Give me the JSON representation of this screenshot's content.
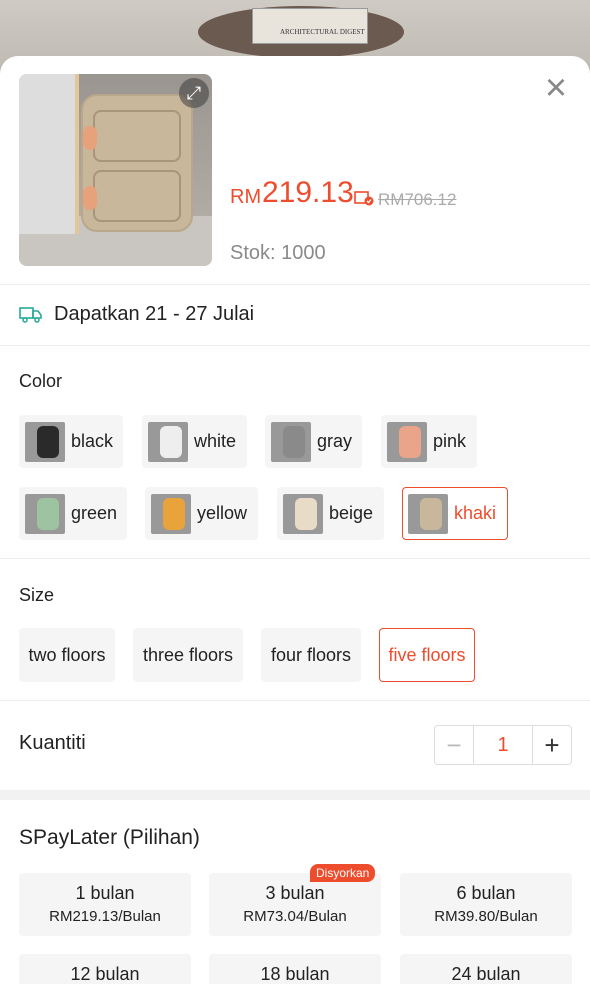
{
  "background": {
    "book_text": "ARCHITECTURAL DIGEST"
  },
  "product": {
    "currency": "RM",
    "price": "219.13",
    "original_price": "RM706.12",
    "stock": "Stok: 1000"
  },
  "delivery": {
    "text": "Dapatkan 21 - 27 Julai"
  },
  "color": {
    "title": "Color",
    "options": [
      {
        "label": "black",
        "swatch": "#2a2a2a"
      },
      {
        "label": "white",
        "swatch": "#eeeeee"
      },
      {
        "label": "gray",
        "swatch": "#8a8a8a"
      },
      {
        "label": "pink",
        "swatch": "#e9a48a"
      },
      {
        "label": "green",
        "swatch": "#9ec3a0"
      },
      {
        "label": "yellow",
        "swatch": "#e8a33a"
      },
      {
        "label": "beige",
        "swatch": "#e9dcc7"
      },
      {
        "label": "khaki",
        "swatch": "#c8b79b"
      }
    ],
    "selected": "khaki"
  },
  "size": {
    "title": "Size",
    "options": [
      "two floors",
      "three floors",
      "four floors",
      "five floors"
    ],
    "selected": "five floors"
  },
  "quantity": {
    "label": "Kuantiti",
    "value": "1",
    "minus": "−",
    "plus": "+"
  },
  "spaylater": {
    "title": "SPayLater (Pilihan)",
    "badge": "Disyorkan",
    "plans": [
      {
        "months": "1 bulan",
        "amount": "RM219.13/Bulan"
      },
      {
        "months": "3 bulan",
        "amount": "RM73.04/Bulan"
      },
      {
        "months": "6 bulan",
        "amount": "RM39.80/Bulan"
      },
      {
        "months": "12 bulan",
        "amount": ""
      },
      {
        "months": "18 bulan",
        "amount": ""
      },
      {
        "months": "24 bulan",
        "amount": ""
      }
    ]
  },
  "colors": {
    "accent": "#ee4d2d",
    "delivery_icon": "#26aa99"
  }
}
